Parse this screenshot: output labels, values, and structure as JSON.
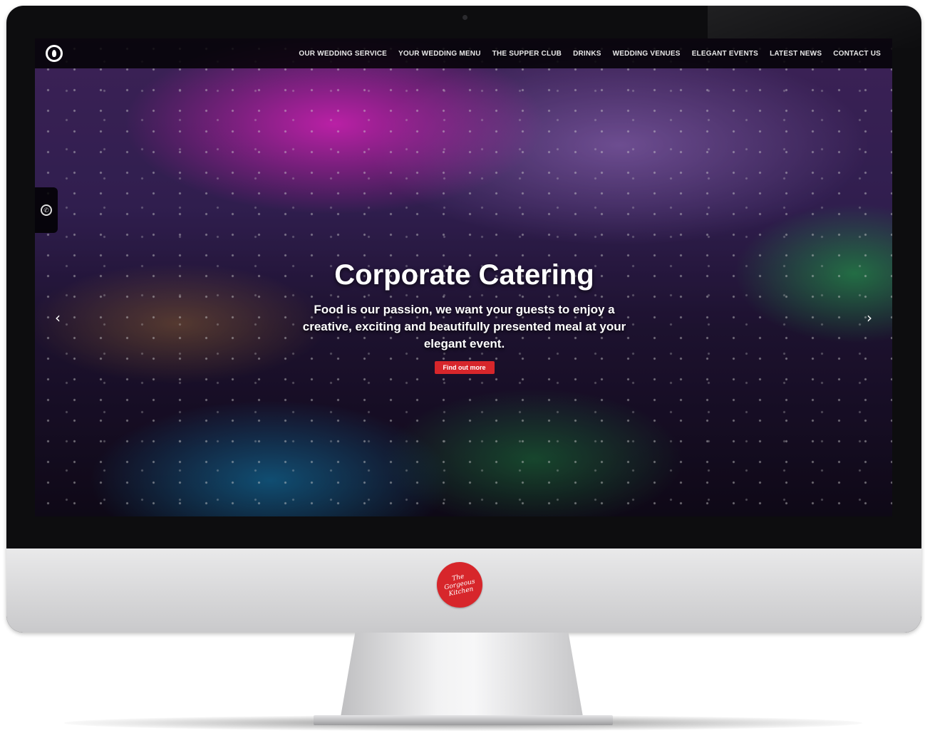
{
  "navbar": {
    "brand_icon": "flame-logo-icon",
    "items": [
      {
        "label": "OUR WEDDING SERVICE"
      },
      {
        "label": "YOUR WEDDING MENU"
      },
      {
        "label": "THE SUPPER CLUB"
      },
      {
        "label": "DRINKS"
      },
      {
        "label": "WEDDING VENUES"
      },
      {
        "label": "ELEGANT EVENTS"
      },
      {
        "label": "LATEST NEWS"
      },
      {
        "label": "CONTACT US"
      }
    ]
  },
  "side_tab": {
    "icon": "phone-icon"
  },
  "slider": {
    "prev_icon": "chevron-left-icon",
    "next_icon": "chevron-right-icon",
    "title": "Corporate Catering",
    "text": "Food is our passion, we want your guests to enjoy a creative, exciting and beautifully presented meal at your elegant event.",
    "button_label": "Find out more"
  },
  "chin_logo": {
    "text": "The Gorgeous Kitchen"
  },
  "colors": {
    "accent": "#d7262b",
    "navbar_bg": "#000000"
  }
}
